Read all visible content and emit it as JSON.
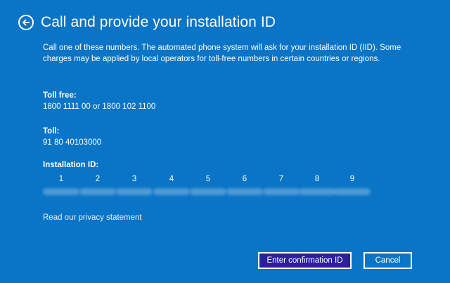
{
  "header": {
    "title": "Call and provide your installation ID",
    "back_icon": "back-arrow-icon"
  },
  "description": "Call one of these numbers. The automated phone system will ask for your installation ID (IID). Some charges may be applied by local operators for toll-free numbers in certain countries or regions.",
  "toll_free": {
    "label": "Toll free:",
    "value": "1800 1111 00 or 1800 102 1100"
  },
  "toll": {
    "label": "Toll:",
    "value": "91 80 40103000"
  },
  "installation_id": {
    "label": "Installation ID:",
    "groups": [
      {
        "number": "1"
      },
      {
        "number": "2"
      },
      {
        "number": "3"
      },
      {
        "number": "4"
      },
      {
        "number": "5"
      },
      {
        "number": "6"
      },
      {
        "number": "7"
      },
      {
        "number": "8"
      },
      {
        "number": "9"
      }
    ]
  },
  "privacy_link": "Read our privacy statement",
  "buttons": {
    "confirm": "Enter confirmation ID",
    "cancel": "Cancel"
  },
  "colors": {
    "background": "#0a74c6",
    "primary_button": "#2a1f9e",
    "text": "#ffffff"
  }
}
